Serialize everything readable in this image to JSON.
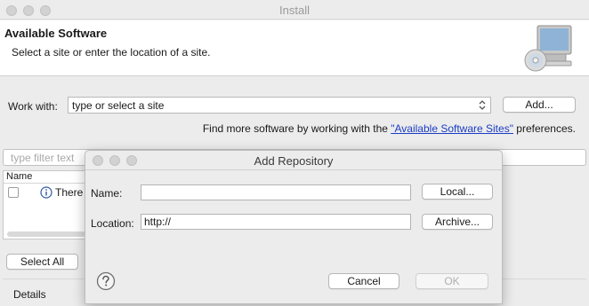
{
  "window": {
    "title": "Install"
  },
  "banner": {
    "title": "Available Software",
    "subtitle": "Select a site or enter the location of a site."
  },
  "work_with": {
    "label": "Work with:",
    "value": "type or select a site",
    "add_button": "Add..."
  },
  "find_more": {
    "prefix": "Find more software by working with the ",
    "link": "\"Available Software Sites\"",
    "suffix": " preferences."
  },
  "filter": {
    "placeholder": "type filter text"
  },
  "table": {
    "header": "Name",
    "row_text": "There i"
  },
  "select_all_button": "Select All",
  "details_label": "Details",
  "dialog": {
    "title": "Add Repository",
    "name_label": "Name:",
    "name_value": "",
    "location_label": "Location:",
    "location_value": "http://",
    "local_button": "Local...",
    "archive_button": "Archive...",
    "cancel_button": "Cancel",
    "ok_button": "OK"
  },
  "icons": {
    "banner": "computer-cd-icon",
    "info": "info-icon",
    "help": "help-icon",
    "combo": "chevron-updown-icon"
  },
  "colors": {
    "link": "#1a3cc4",
    "window_bg": "#ececec",
    "disabled_text": "#b0b0b0"
  }
}
